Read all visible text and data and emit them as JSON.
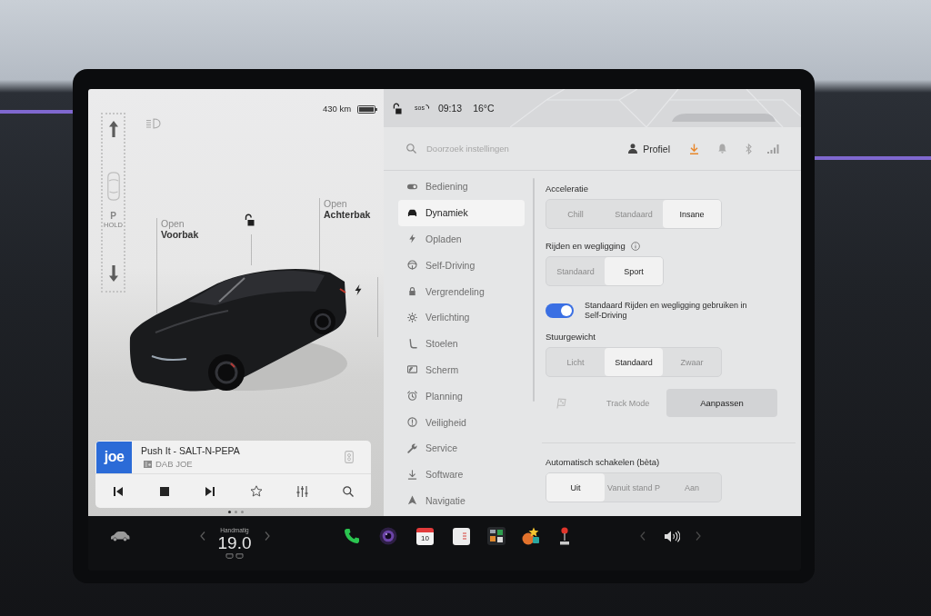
{
  "car_panel": {
    "range": "430 km",
    "gear": {
      "position": "P",
      "mode": "HOLD"
    },
    "frunk": {
      "action": "Open",
      "label": "Voorbak"
    },
    "trunk": {
      "action": "Open",
      "label": "Achterbak"
    },
    "locked": false,
    "media": {
      "logo": "joe",
      "title": "Push It - SALT-N-PEPA",
      "source": "DAB JOE"
    },
    "pager": [
      {
        "selected": true
      },
      {
        "selected": false
      },
      {
        "selected": false
      }
    ]
  },
  "status_bar": {
    "locked": false,
    "sos": "sos",
    "time": "09:13",
    "temperature": "16°C"
  },
  "settings": {
    "search": {
      "placeholder": "Doorzoek instellingen"
    },
    "profile": "Profiel",
    "menu": [
      {
        "label": "Bediening",
        "selected": false
      },
      {
        "label": "Dynamiek",
        "selected": true
      },
      {
        "label": "Opladen",
        "selected": false
      },
      {
        "label": "Self-Driving",
        "selected": false
      },
      {
        "label": "Vergrendeling",
        "selected": false
      },
      {
        "label": "Verlichting",
        "selected": false
      },
      {
        "label": "Stoelen",
        "selected": false
      },
      {
        "label": "Scherm",
        "selected": false
      },
      {
        "label": "Planning",
        "selected": false
      },
      {
        "label": "Veiligheid",
        "selected": false
      },
      {
        "label": "Service",
        "selected": false
      },
      {
        "label": "Software",
        "selected": false
      },
      {
        "label": "Navigatie",
        "selected": false
      }
    ],
    "sections": [
      {
        "kind": "segmented",
        "title": "Acceleratie",
        "options": [
          {
            "label": "Chill",
            "selected": false
          },
          {
            "label": "Standaard",
            "selected": false
          },
          {
            "label": "Insane",
            "selected": true
          }
        ]
      },
      {
        "kind": "segmented",
        "title": "Rijden en wegligging",
        "info": true,
        "options": [
          {
            "label": "Standaard",
            "selected": false
          },
          {
            "label": "Sport",
            "selected": true
          }
        ]
      },
      {
        "kind": "toggle",
        "label": "Standaard Rijden en wegligging gebruiken in Self-Driving",
        "on": true
      },
      {
        "kind": "segmented",
        "title": "Stuurgewicht",
        "options": [
          {
            "label": "Licht",
            "selected": false
          },
          {
            "label": "Standaard",
            "selected": true
          },
          {
            "label": "Zwaar",
            "selected": false
          }
        ]
      },
      {
        "kind": "track",
        "label": "Track Mode",
        "disabled": true,
        "button": "Aanpassen"
      },
      {
        "kind": "segmented",
        "title": "Automatisch schakelen (bèta)",
        "options": [
          {
            "label": "Uit",
            "selected": true
          },
          {
            "label": "Vanuit stand P",
            "selected": false
          },
          {
            "label": "Aan",
            "selected": false
          }
        ]
      }
    ]
  },
  "taskbar": {
    "climate": {
      "mode": "Handmatig",
      "temperature": "19.0"
    },
    "calendar_day": "10"
  }
}
